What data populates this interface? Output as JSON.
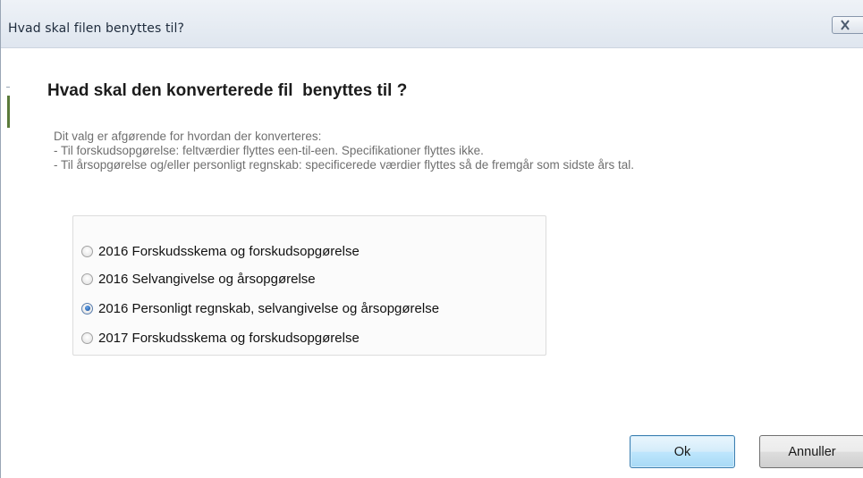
{
  "window": {
    "title": "Hvad skal filen benyttes til?",
    "close_icon": "close-icon"
  },
  "content": {
    "heading": "Hvad skal den konverterede fil  benyttes til ?",
    "description": [
      "Dit valg er afgørende for hvordan der konverteres:",
      "- Til forskudsopgørelse: feltværdier flyttes een-til-een. Specifikationer flyttes ikke.",
      "- Til årsopgørelse og/eller personligt regnskab: specificerede værdier flyttes så de fremgår som sidste års tal."
    ]
  },
  "options": {
    "items": [
      {
        "label": "2016 Forskudsskema og forskudsopgørelse",
        "checked": false
      },
      {
        "label": "2016 Selvangivelse og årsopgørelse",
        "checked": false
      },
      {
        "label": "2016 Personligt regnskab, selvangivelse og årsopgørelse",
        "checked": true
      },
      {
        "label": "2017 Forskudsskema og forskudsopgørelse",
        "checked": false
      }
    ],
    "selected": "2016 Personligt regnskab, selvangivelse og årsopgørelse"
  },
  "buttons": {
    "ok_label": "Ok",
    "cancel_label": "Annuller"
  },
  "colors": {
    "accent": "#3c7fb1",
    "title_bar": "#dfe6ef",
    "description_text": "#6f6f6f"
  }
}
